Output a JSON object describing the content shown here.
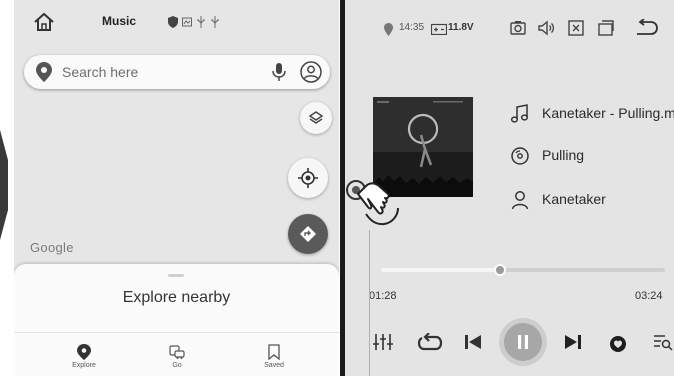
{
  "left": {
    "app_title": "Music",
    "search": {
      "placeholder": "Search here"
    },
    "google_logo": "Google",
    "sheet_title": "Explore nearby",
    "nav": [
      {
        "label": "Explore",
        "icon": "location-pin-icon"
      },
      {
        "label": "Go",
        "icon": "commute-icon"
      },
      {
        "label": "Saved",
        "icon": "bookmark-icon"
      }
    ]
  },
  "right": {
    "time": "14:35",
    "voltage": "11.8V",
    "track": {
      "file": "Kanetaker - Pulling.mp",
      "title": "Pulling",
      "artist": "Kanetaker",
      "elapsed": "01:28",
      "duration": "03:24",
      "progress": 0.42
    }
  },
  "colors": {
    "accent_dark": "#5a5a5a",
    "divider": "#1a1a1a"
  }
}
